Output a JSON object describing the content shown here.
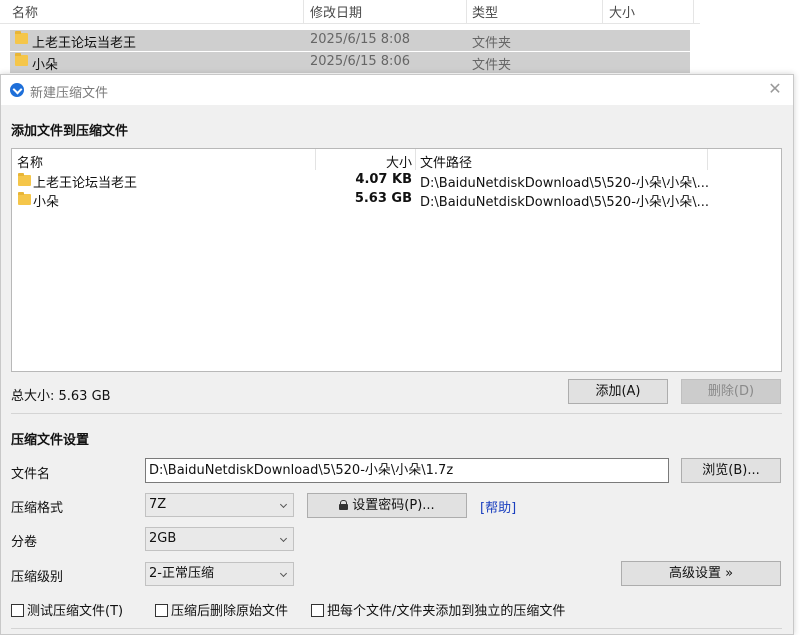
{
  "explorer": {
    "columns": [
      "名称",
      "修改日期",
      "类型",
      "大小"
    ],
    "rows": [
      {
        "name": "上老王论坛当老王",
        "date": "2025/6/15 8:08",
        "type": "文件夹"
      },
      {
        "name": "小朵",
        "date": "2025/6/15 8:06",
        "type": "文件夹"
      }
    ]
  },
  "dialog": {
    "title": "新建压缩文件",
    "add_section_title": "添加文件到压缩文件",
    "filelist": {
      "columns": {
        "name": "名称",
        "size": "大小",
        "path": "文件路径"
      },
      "rows": [
        {
          "name": "上老王论坛当老王",
          "size": "4.07 KB",
          "path": "D:\\BaiduNetdiskDownload\\5\\520-小朵\\小朵\\..."
        },
        {
          "name": "小朵",
          "size": "5.63 GB",
          "path": "D:\\BaiduNetdiskDownload\\5\\520-小朵\\小朵\\..."
        }
      ]
    },
    "total_size": "总大小: 5.63 GB",
    "add_button": "添加(A)",
    "delete_button": "删除(D)",
    "settings_title": "压缩文件设置",
    "filename_label": "文件名",
    "filename_value": "D:\\BaiduNetdiskDownload\\5\\520-小朵\\小朵\\1.7z",
    "browse_button": "浏览(B)...",
    "format_label": "压缩格式",
    "format_value": "7Z",
    "password_button": "设置密码(P)...",
    "help_link": "[帮助]",
    "volume_label": "分卷",
    "volume_value": "2GB",
    "level_label": "压缩级别",
    "level_value": "2-正常压缩",
    "advanced_button": "高级设置 »",
    "checkboxes": {
      "test": "测试压缩文件(T)",
      "delete_after": "压缩后删除原始文件",
      "separate": "把每个文件/文件夹添加到独立的压缩文件"
    }
  }
}
